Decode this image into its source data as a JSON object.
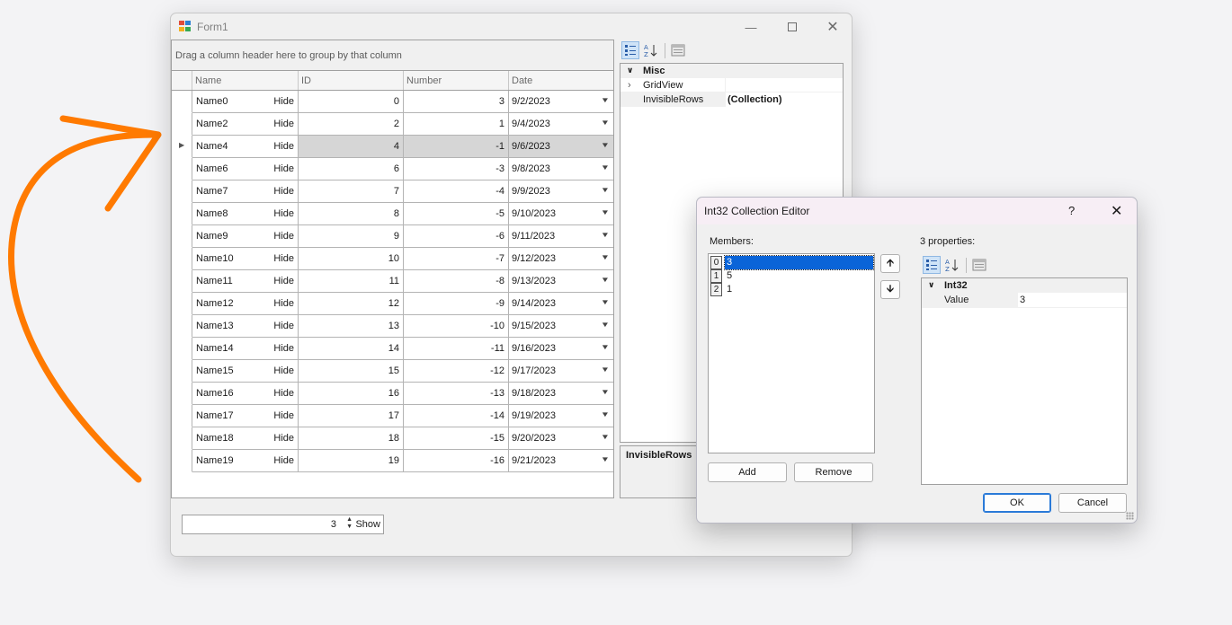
{
  "form": {
    "title": "Form1",
    "grid": {
      "group_panel_text": "Drag a column header here to group by that column",
      "columns": [
        "Name",
        "ID",
        "Number",
        "Date"
      ],
      "selected_row": 2,
      "rows": [
        {
          "name": "Name0",
          "action": "Hide",
          "id": "0",
          "number": "3",
          "date": "9/2/2023"
        },
        {
          "name": "Name2",
          "action": "Hide",
          "id": "2",
          "number": "1",
          "date": "9/4/2023"
        },
        {
          "name": "Name4",
          "action": "Hide",
          "id": "4",
          "number": "-1",
          "date": "9/6/2023"
        },
        {
          "name": "Name6",
          "action": "Hide",
          "id": "6",
          "number": "-3",
          "date": "9/8/2023"
        },
        {
          "name": "Name7",
          "action": "Hide",
          "id": "7",
          "number": "-4",
          "date": "9/9/2023"
        },
        {
          "name": "Name8",
          "action": "Hide",
          "id": "8",
          "number": "-5",
          "date": "9/10/2023"
        },
        {
          "name": "Name9",
          "action": "Hide",
          "id": "9",
          "number": "-6",
          "date": "9/11/2023"
        },
        {
          "name": "Name10",
          "action": "Hide",
          "id": "10",
          "number": "-7",
          "date": "9/12/2023"
        },
        {
          "name": "Name11",
          "action": "Hide",
          "id": "11",
          "number": "-8",
          "date": "9/13/2023"
        },
        {
          "name": "Name12",
          "action": "Hide",
          "id": "12",
          "number": "-9",
          "date": "9/14/2023"
        },
        {
          "name": "Name13",
          "action": "Hide",
          "id": "13",
          "number": "-10",
          "date": "9/15/2023"
        },
        {
          "name": "Name14",
          "action": "Hide",
          "id": "14",
          "number": "-11",
          "date": "9/16/2023"
        },
        {
          "name": "Name15",
          "action": "Hide",
          "id": "15",
          "number": "-12",
          "date": "9/17/2023"
        },
        {
          "name": "Name16",
          "action": "Hide",
          "id": "16",
          "number": "-13",
          "date": "9/18/2023"
        },
        {
          "name": "Name17",
          "action": "Hide",
          "id": "17",
          "number": "-14",
          "date": "9/19/2023"
        },
        {
          "name": "Name18",
          "action": "Hide",
          "id": "18",
          "number": "-15",
          "date": "9/20/2023"
        },
        {
          "name": "Name19",
          "action": "Hide",
          "id": "19",
          "number": "-16",
          "date": "9/21/2023"
        }
      ]
    },
    "property_grid": {
      "category": "Misc",
      "rows": [
        {
          "name": "GridView",
          "value": "",
          "expandable": true
        },
        {
          "name": "InvisibleRows",
          "value": "(Collection)",
          "expandable": false
        }
      ],
      "description_title": "InvisibleRows"
    },
    "numeric": {
      "value": "3",
      "button_label": "Show"
    }
  },
  "dialog": {
    "title": "Int32 Collection Editor",
    "help_glyph": "?",
    "members_label": "Members:",
    "members": [
      {
        "index": "0",
        "value": "3",
        "selected": true
      },
      {
        "index": "1",
        "value": "5",
        "selected": false
      },
      {
        "index": "2",
        "value": "1",
        "selected": false
      }
    ],
    "add_label": "Add",
    "remove_label": "Remove",
    "properties_label": "3 properties:",
    "properties": {
      "category": "Int32",
      "rows": [
        {
          "name": "Value",
          "value": "3"
        }
      ]
    },
    "ok_label": "OK",
    "cancel_label": "Cancel"
  },
  "colors": {
    "annotation_arrow": "#ff7a00",
    "selection": "#0a64d8"
  }
}
